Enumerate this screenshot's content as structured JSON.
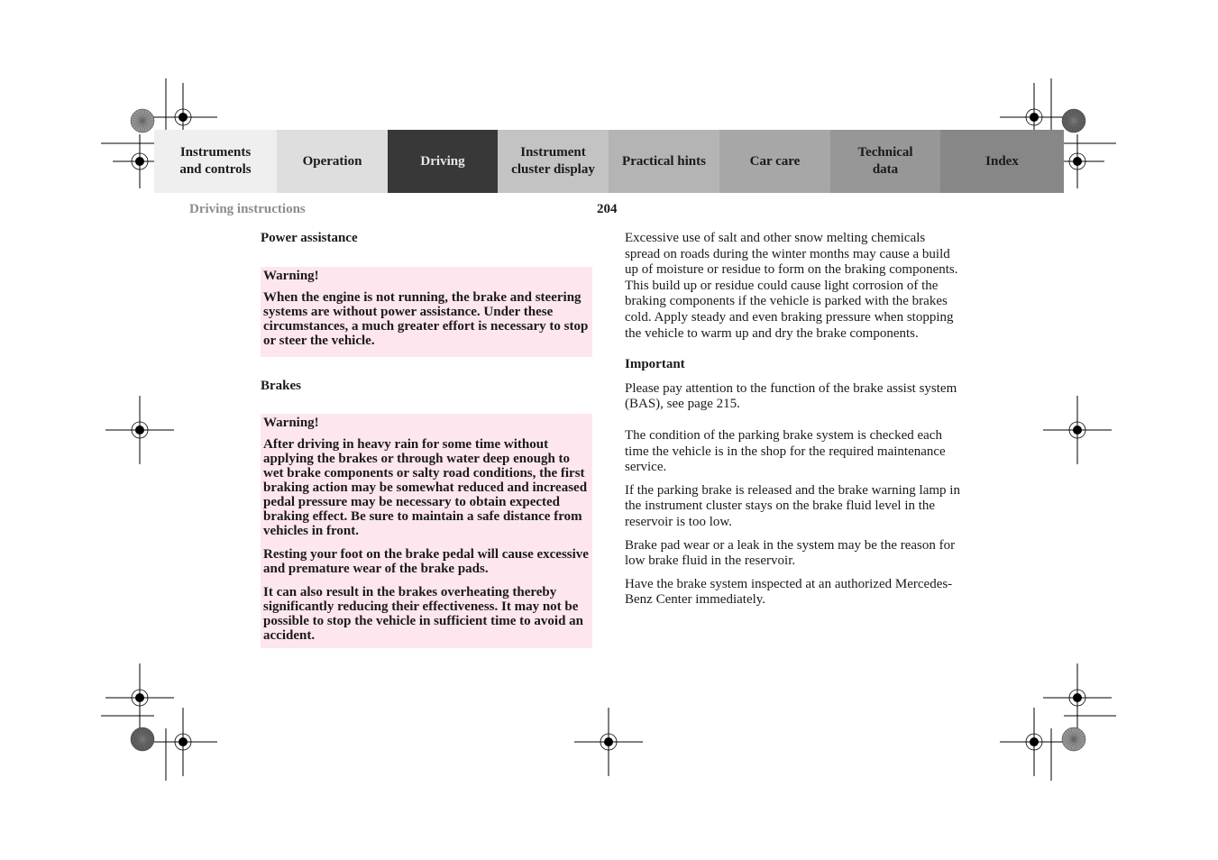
{
  "nav": {
    "tabs": [
      {
        "label": "Instruments\nand controls",
        "bg": "#efefef",
        "active": false
      },
      {
        "label": "Operation",
        "bg": "#dedede",
        "active": false
      },
      {
        "label": "Driving",
        "bg": "#383838",
        "active": true
      },
      {
        "label": "Instrument\ncluster display",
        "bg": "#c3c3c3",
        "active": false
      },
      {
        "label": "Practical hints",
        "bg": "#b4b4b4",
        "active": false
      },
      {
        "label": "Car care",
        "bg": "#a7a7a7",
        "active": false
      },
      {
        "label": "Technical\ndata",
        "bg": "#979797",
        "active": false
      },
      {
        "label": "Index",
        "bg": "#878787",
        "active": false
      }
    ]
  },
  "header": {
    "section": "Driving instructions",
    "page_number": "204"
  },
  "left": {
    "power": {
      "heading": "Power assistance",
      "warning_title": "Warning!",
      "paragraphs": [
        "When the engine is not running, the brake and steering systems are without power assistance. Under these circumstances, a much greater effort is necessary to stop or steer the vehicle."
      ]
    },
    "brakes": {
      "heading": "Brakes",
      "warning_title": "Warning!",
      "paragraphs": [
        "After driving in heavy rain for some time without applying the brakes or through water deep enough to wet brake components or salty road conditions, the first braking action may be somewhat reduced and increased pedal pressure may be necessary to obtain expected braking effect. Be sure to maintain a safe distance from vehicles in front.",
        "Resting your foot on the brake pedal will cause excessive and premature wear of the brake pads.",
        "It can also result in the brakes overheating thereby significantly reducing their effectiveness. It may not be possible to stop the vehicle in sufficient time to avoid an accident."
      ]
    }
  },
  "right": {
    "intro": "Excessive use of salt and other snow melting chemicals spread on roads during the winter months may cause a build up of moisture or residue to form on the braking components. This build up or residue could cause light corrosion of the braking components if the vehicle is parked with the brakes cold. Apply steady and even braking pressure when stopping the vehicle to warm up and dry the brake components.",
    "important_heading": "Important",
    "important_text": "Please pay attention to the function of the brake assist system (BAS), see page 215.",
    "paragraphs": [
      "The condition of the parking brake system is checked each time the vehicle is in the shop for the required maintenance service.",
      "If the parking brake is released and the brake warning lamp in the instrument cluster stays on the brake fluid level in the reservoir is too low.",
      "Brake pad wear or a leak in the system may be the reason for low brake fluid in the reservoir.",
      "Have the brake system inspected at an authorized Mercedes-Benz Center immediately."
    ]
  },
  "colors": {
    "warning_bg": "#fde6ee",
    "running_head": "#8c8c8c",
    "active_tab_text": "#e6e6e6"
  }
}
